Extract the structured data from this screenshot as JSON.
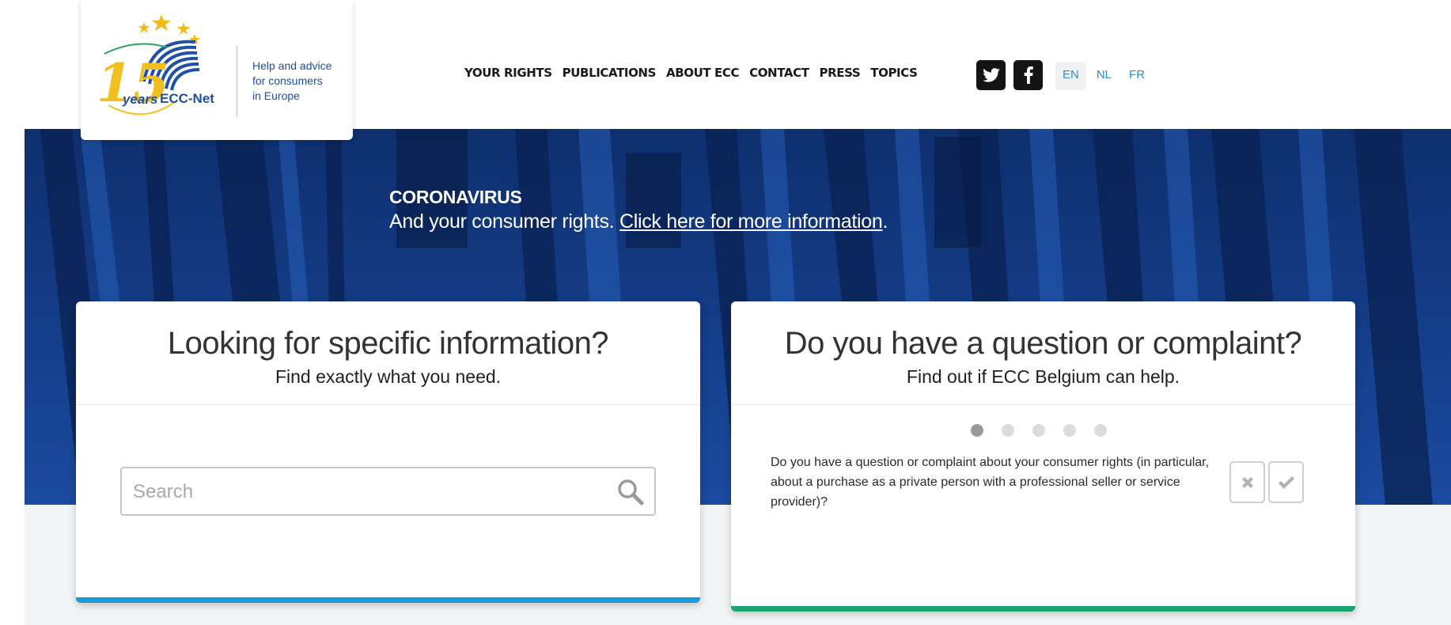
{
  "logo": {
    "big_number": "15",
    "years_text": "years",
    "network_text": "ECC-Net",
    "tagline": [
      "Help and advice",
      "for consumers",
      "in Europe"
    ]
  },
  "nav": {
    "items": [
      "YOUR RIGHTS",
      "PUBLICATIONS",
      "ABOUT ECC",
      "CONTACT",
      "PRESS",
      "TOPICS"
    ]
  },
  "social": {
    "twitter_icon": "twitter-icon",
    "facebook_icon": "facebook-icon"
  },
  "languages": {
    "items": [
      "EN",
      "NL",
      "FR"
    ],
    "active": "EN"
  },
  "notice": {
    "title": "CORONAVIRUS",
    "text_before": "And your consumer rights. ",
    "link_text": "Click here for more information",
    "text_after": "."
  },
  "search_card": {
    "title": "Looking for specific information?",
    "subtitle": "Find exactly what you need.",
    "search_placeholder": "Search",
    "accent_color": "#1a9ad6"
  },
  "question_card": {
    "title": "Do you have a question or complaint?",
    "subtitle": "Find out if ECC Belgium can help.",
    "step_current": 1,
    "step_total": 5,
    "question": "Do you have a question or complaint about your consumer rights (in particular, about a purchase as a private person with a professional seller or service provider)?",
    "no_icon": "cross-icon",
    "yes_icon": "check-icon",
    "accent_color": "#1da36b"
  },
  "colors": {
    "hero_blue": "#123a82",
    "link_blue": "#2f8ccf",
    "logo_blue": "#1f4fa0",
    "logo_yellow": "#f0c020"
  }
}
